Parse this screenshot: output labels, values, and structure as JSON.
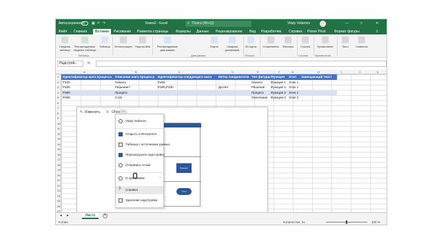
{
  "titlebar": {
    "autosave": "Автосохранение",
    "doc_title": "Книга2 - Excel",
    "search_placeholder": "Поиск (Alt+Q)",
    "user": "Vitaly Vedenev"
  },
  "menubar": {
    "tabs": [
      "Файл",
      "Главная",
      "Вставка",
      "Рисование",
      "Разметка страницы",
      "Формулы",
      "Данные",
      "Рецензирование",
      "Вид",
      "Разработчик",
      "Справка",
      "Power Pivot",
      "Формат фигуры"
    ],
    "active": "Вставка"
  },
  "ribbon": {
    "buttons": [
      "Сводная таблица",
      "Рекомендуемые сводные таблицы",
      "Таблица",
      "Иллюстрации",
      "Надстройки",
      "Рекомендуемые диаграммы",
      "Карты",
      "Сводная диаграмма",
      "3D-карта",
      "Спарклайны",
      "Фильтры",
      "Ссылка",
      "Примечание",
      "Текст",
      "Символы"
    ],
    "groups": [
      "Таблицы",
      "Диаграммы",
      "Обзоры",
      "Ссылки",
      "Примечания"
    ]
  },
  "formula_bar": {
    "name_box": "Надстрой...",
    "fx": "fx"
  },
  "columns": [
    "A",
    "B",
    "C",
    "D",
    "E",
    "F",
    "G",
    "H",
    "I",
    "J",
    "K"
  ],
  "rows": [
    "1",
    "2",
    "3",
    "4",
    "5",
    "6",
    "7",
    "8",
    "9",
    "10",
    "11",
    "12",
    "13",
    "14",
    "15",
    "16",
    "17",
    "18",
    "19",
    "20",
    "21",
    "22",
    "23",
    "24",
    "25",
    "26",
    "27"
  ],
  "table": {
    "headers": [
      "Идентификатор шага процесса",
      "Описание шага процесса",
      "Идентификатор следующего шага",
      "Метка соединителя",
      "Тип фигуры",
      "Функция",
      "Этап",
      "Замещающий текст"
    ],
    "rows": [
      [
        "P100",
        "Начало",
        "P200",
        "",
        "Начало",
        "Функция 1",
        "Этап 1",
        ""
      ],
      [
        "P200",
        "Решение?",
        "P300,P400",
        "Да,Нет",
        "Решение",
        "Функция 1",
        "Этап 1",
        ""
      ],
      [
        "P300",
        "Процесс",
        "",
        "",
        "Процесс",
        "Функция 2",
        "Этап 1",
        ""
      ],
      [
        "P400",
        "Стоп",
        "",
        "",
        "Окончание",
        "Функция 3",
        "Этап 2",
        ""
      ]
    ]
  },
  "pane": {
    "edit": "Изменить",
    "refresh": "Обновить",
    "more": "...",
    "diagram_labels": [
      "Процесс",
      "Стоп"
    ]
  },
  "menu": {
    "user": "Vitaly Vedenev",
    "items": [
      "Открыть в Интернете",
      "Таблица с источником данных",
      "Перезагрузите надстройку",
      "Отправить отзыв",
      "О программе",
      "Справка",
      "Удаление надстройки"
    ]
  },
  "sheets": {
    "active": "Лист1",
    "add": "+"
  },
  "status": {
    "ready": "Готово",
    "count": "Количество: 31",
    "zoom": "100 %"
  },
  "colors": {
    "excel_green": "#217346",
    "table_header": "#4472c4",
    "table_band": "#d9e1f2",
    "diagram_blue": "#2b579a"
  }
}
